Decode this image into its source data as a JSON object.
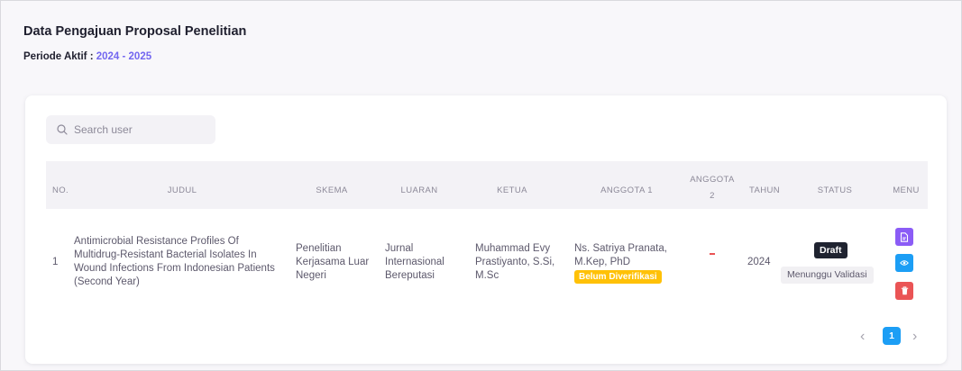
{
  "header": {
    "title": "Data Pengajuan Proposal Penelitian",
    "periode_label": "Periode Aktif : ",
    "periode_value": "2024 - 2025"
  },
  "search": {
    "placeholder": "Search user"
  },
  "table": {
    "columns": {
      "no": "NO.",
      "judul": "JUDUL",
      "skema": "SKEMA",
      "luaran": "LUARAN",
      "ketua": "KETUA",
      "anggota1": "ANGGOTA 1",
      "anggota2_line1": "ANGGOTA",
      "anggota2_line2": "2",
      "tahun": "TAHUN",
      "status": "STATUS",
      "menu": "MENU"
    },
    "rows": [
      {
        "no": "1",
        "judul": [
          "Antimicrobial Resistance Profiles Of",
          "Multidrug-Resistant Bacterial Isolates In",
          "Wound Infections From Indonesian Patients",
          "(Second Year)"
        ],
        "skema": [
          "Penelitian",
          "Kerjasama Luar",
          "Negeri"
        ],
        "luaran": [
          "Jurnal",
          "Internasional",
          "Bereputasi"
        ],
        "ketua": [
          "Muhammad Evy",
          "Prastiyanto, S.Si,",
          "M.Sc"
        ],
        "anggota1": [
          "Ns. Satriya Pranata,",
          "M.Kep, PhD"
        ],
        "anggota1_badge": "Belum Diverifikasi",
        "anggota2": "-",
        "tahun": "2024",
        "status_badge": "Draft",
        "status_text": "Menunggu Validasi",
        "menu_icons": [
          "document-pdf-icon",
          "eye-icon",
          "trash-icon"
        ]
      }
    ]
  },
  "pagination": {
    "prev": "‹",
    "current": "1",
    "next": "›"
  },
  "colors": {
    "accent": "#7367f0",
    "info": "#1c9ef5",
    "danger": "#ea5455",
    "warning": "#ffc107",
    "dark": "#1f2330"
  }
}
